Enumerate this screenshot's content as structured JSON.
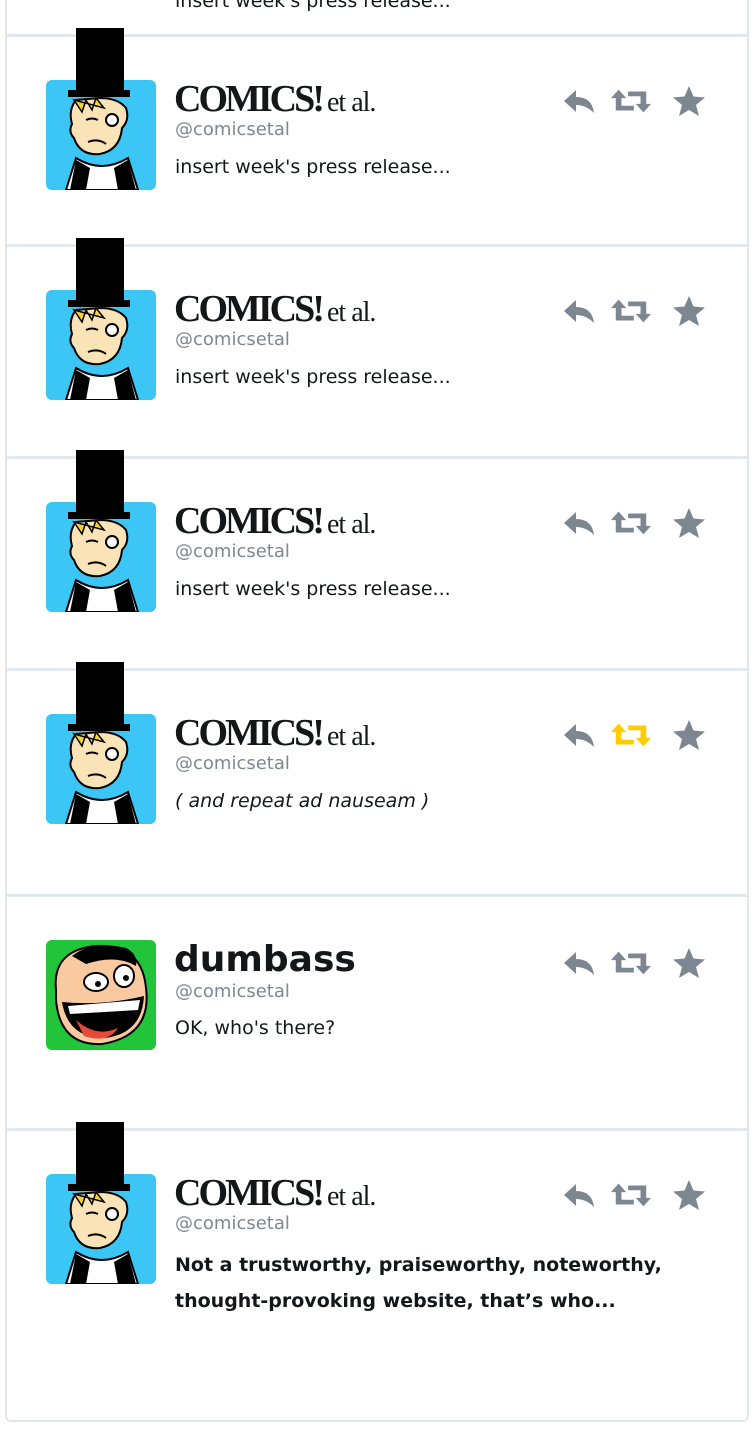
{
  "colors": {
    "icon": "#7d8791",
    "retweet_active": "#ffcc00",
    "avatar_blue": "#3cc6f5",
    "avatar_green": "#22c43a",
    "divider": "#e1e8ed"
  },
  "top_fragment": "insert week's press release...",
  "tweets": [
    {
      "name_logo": "COMICS!",
      "name_suffix": "et al.",
      "handle": "@comicsetal",
      "text": "insert week's press release...",
      "avatar": "tophat-man",
      "retweeted": false
    },
    {
      "name_logo": "COMICS!",
      "name_suffix": "et al.",
      "handle": "@comicsetal",
      "text": "insert week's press release...",
      "avatar": "tophat-man",
      "retweeted": false
    },
    {
      "name_logo": "COMICS!",
      "name_suffix": "et al.",
      "handle": "@comicsetal",
      "text": "insert week's press release...",
      "avatar": "tophat-man",
      "retweeted": false
    },
    {
      "name_logo": "COMICS!",
      "name_suffix": "et al.",
      "handle": "@comicsetal",
      "text": "( and repeat ad nauseam )",
      "avatar": "tophat-man",
      "retweeted": true
    },
    {
      "name_plain": "dumbass",
      "handle": "@comicsetal",
      "text": "OK, who's there?",
      "avatar": "laughing-man",
      "retweeted": false
    },
    {
      "name_logo": "COMICS!",
      "name_suffix": "et al.",
      "handle": "@comicsetal",
      "text": "Not a trustworthy, praiseworthy, noteworthy, thought-provoking website, that’s who...",
      "avatar": "tophat-man",
      "retweeted": false
    }
  ],
  "icons": {
    "reply": "reply-icon",
    "retweet": "retweet-icon",
    "favorite": "star-icon"
  }
}
